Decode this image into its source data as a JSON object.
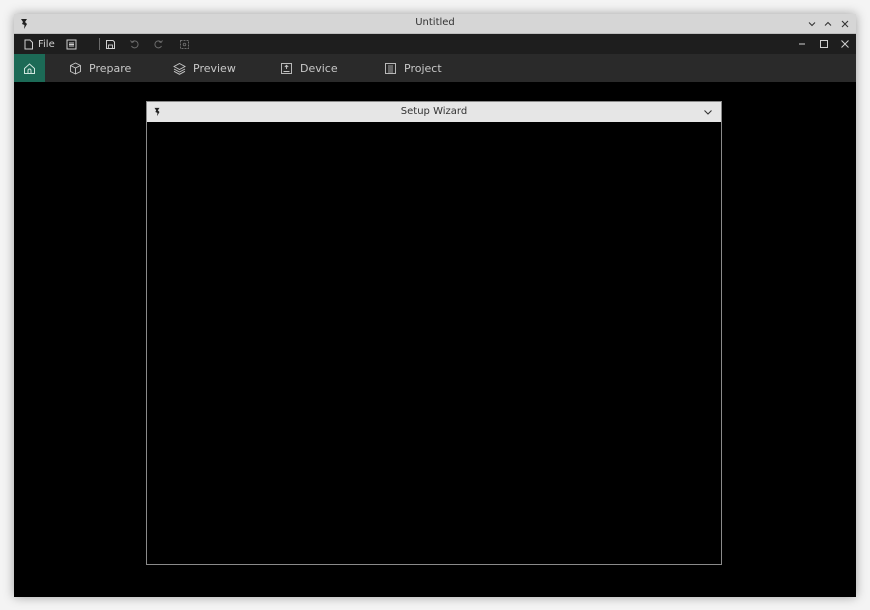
{
  "window": {
    "title": "Untitled"
  },
  "menubar": {
    "file_label": "File"
  },
  "tabs": [
    {
      "label": "Prepare",
      "icon": "cube-icon"
    },
    {
      "label": "Preview",
      "icon": "layers-icon"
    },
    {
      "label": "Device",
      "icon": "device-icon"
    },
    {
      "label": "Project",
      "icon": "project-icon"
    }
  ],
  "dialog": {
    "title": "Setup Wizard"
  },
  "colors": {
    "accent": "#1c6a56",
    "menubar_bg": "#1e1e1e",
    "tabbar_bg": "#2a2a2a",
    "titlebar_bg": "#d6d6d6"
  }
}
